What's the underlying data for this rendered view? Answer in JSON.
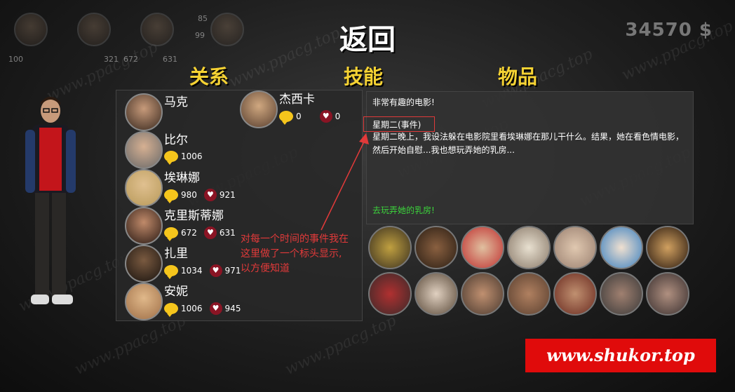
{
  "topbar": {
    "stats": [
      "100",
      "321",
      "672",
      "631",
      "85",
      "99"
    ],
    "money": "34570 $"
  },
  "nav": {
    "back_label": "返回",
    "tabs": [
      "关系",
      "技能",
      "物品"
    ]
  },
  "contacts": [
    {
      "name": "马克",
      "chat": "",
      "affection": ""
    },
    {
      "name": "比尔",
      "chat": "1006",
      "affection": ""
    },
    {
      "name": "埃琳娜",
      "chat": "980",
      "affection": "921"
    },
    {
      "name": "克里斯蒂娜",
      "chat": "672",
      "affection": "631"
    },
    {
      "name": "扎里",
      "chat": "1034",
      "affection": "971"
    },
    {
      "name": "安妮",
      "chat": "1006",
      "affection": "945"
    },
    {
      "name": "杰西卡",
      "chat": "0",
      "affection": "0"
    }
  ],
  "detail": {
    "title": "非常有趣的电影!",
    "event_tag": "星期二(事件)",
    "description": "星期二晚上，我设法躲在电影院里看埃琳娜在那儿干什么。结果，她在看色情电影，然后开始自慰...我也想玩弄她的乳房...",
    "action": "去玩弄她的乳房!"
  },
  "annotation": {
    "text": "对每一个时间的事件我在这里做了一个标头显示, 以方便知道",
    "color": "#e23a3a"
  },
  "watermark": "www.ppacg.top",
  "site_badge": "www.shukor.top",
  "colors": {
    "tab": "#f5d233",
    "action": "#3cd43c",
    "badge": "#e00b0b"
  }
}
